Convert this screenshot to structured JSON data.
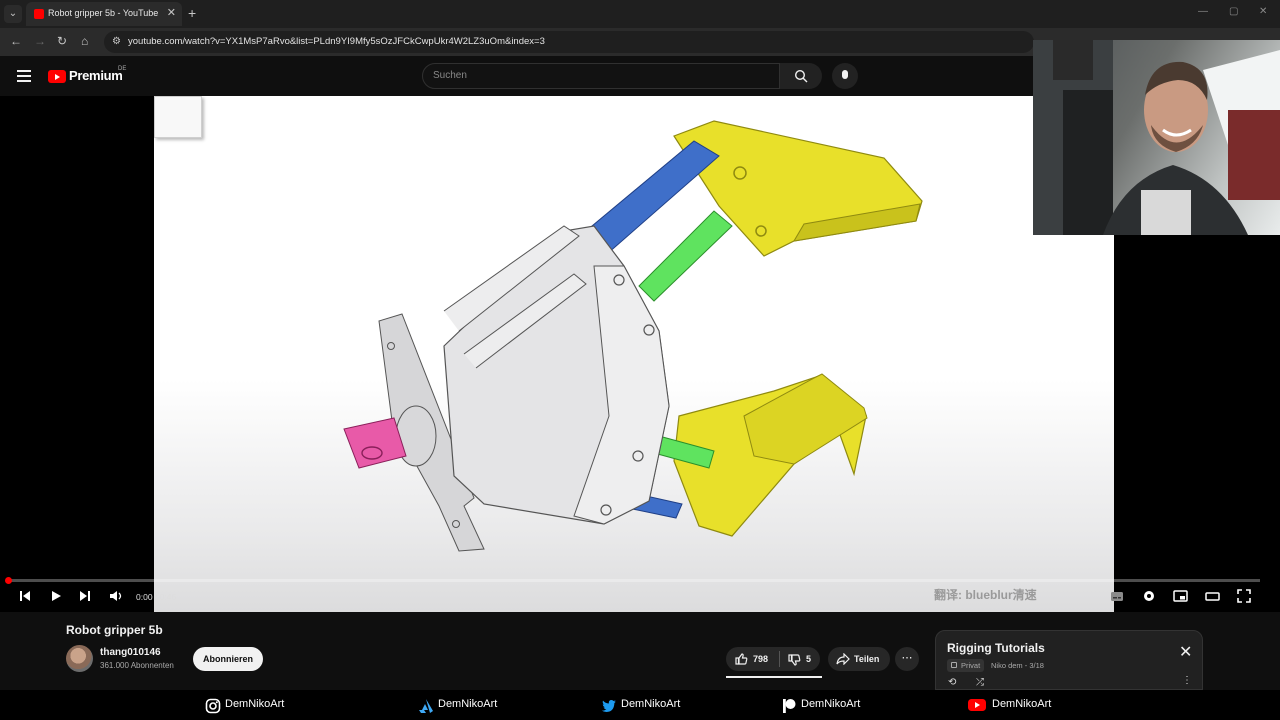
{
  "browser": {
    "tab_title": "Robot gripper 5b - YouTube",
    "url": "youtube.com/watch?v=YX1MsP7aRvo&list=PLdn9YI9Mfy5sOzJFCkCwpUkr4W2LZ3uOm&index=3"
  },
  "header": {
    "brand": "Premium",
    "region": "DE",
    "search_placeholder": "Suchen"
  },
  "player": {
    "time": "0:00 / 0:46",
    "progress_fraction": 0.0,
    "subtitle": "翻译: blueblur清速"
  },
  "video": {
    "title": "Robot gripper 5b",
    "channel": "thang010146",
    "subscribers": "361.000 Abonnenten",
    "subscribe_label": "Abonnieren",
    "likes": "798",
    "dislikes": "5",
    "share_label": "Teilen"
  },
  "playlist": {
    "title": "Rigging Tutorials",
    "privacy": "Privat",
    "meta": "Niko dem - 3/18"
  },
  "social": [
    {
      "platform": "instagram",
      "handle": "DemNikoArt",
      "icon": "instagram-icon"
    },
    {
      "platform": "artstation",
      "handle": "DemNikoArt",
      "icon": "artstation-icon"
    },
    {
      "platform": "twitter",
      "handle": "DemNikoArt",
      "icon": "twitter-icon"
    },
    {
      "platform": "patreon",
      "handle": "DemNikoArt",
      "icon": "patreon-icon"
    },
    {
      "platform": "youtube",
      "handle": "DemNikoArt",
      "icon": "youtube-icon"
    }
  ],
  "colors": {
    "youtube_red": "#ff0000",
    "background": "#0f0f0f",
    "gripper_yellow": "#e8e02a",
    "link_blue": "#3f6fc9",
    "link_green": "#5fe35f",
    "body_grey": "#e4e4e6",
    "motor_pink": "#e85aa8"
  }
}
